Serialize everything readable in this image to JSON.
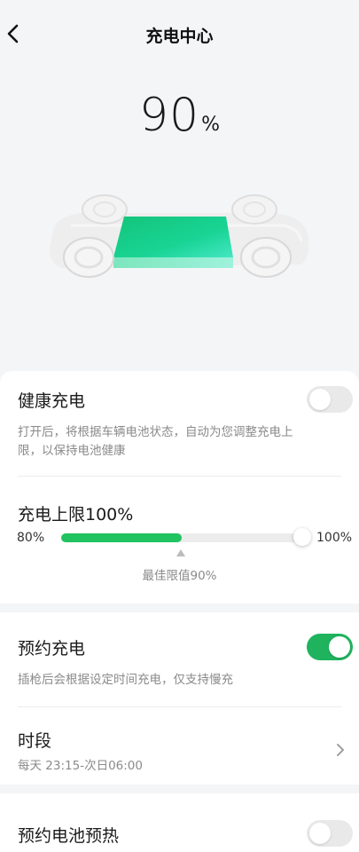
{
  "header": {
    "title": "充电中心",
    "back_icon": "chevron-left-icon"
  },
  "battery": {
    "percent_value": "90",
    "percent_unit": "%"
  },
  "health_charging": {
    "title": "健康充电",
    "description": "打开后，将根据车辆电池状态，自动为您调整充电上限，以保持电池健康",
    "enabled": false
  },
  "charge_limit": {
    "title": "充电上限100%",
    "min_label": "80%",
    "max_label": "100%",
    "value": 100,
    "best_value_label": "最佳限值90%",
    "best_value": 90
  },
  "scheduled_charging": {
    "title": "预约充电",
    "description": "插枪后会根据设定时间充电，仅支持慢充",
    "enabled": true
  },
  "time_period": {
    "title": "时段",
    "value": "每天 23:15-次日06:00",
    "chevron_icon": "chevron-right-icon"
  },
  "battery_preheat": {
    "title": "预约电池预热",
    "enabled": false
  },
  "colors": {
    "accent": "#1fb35e",
    "background": "#f4f5f7"
  }
}
